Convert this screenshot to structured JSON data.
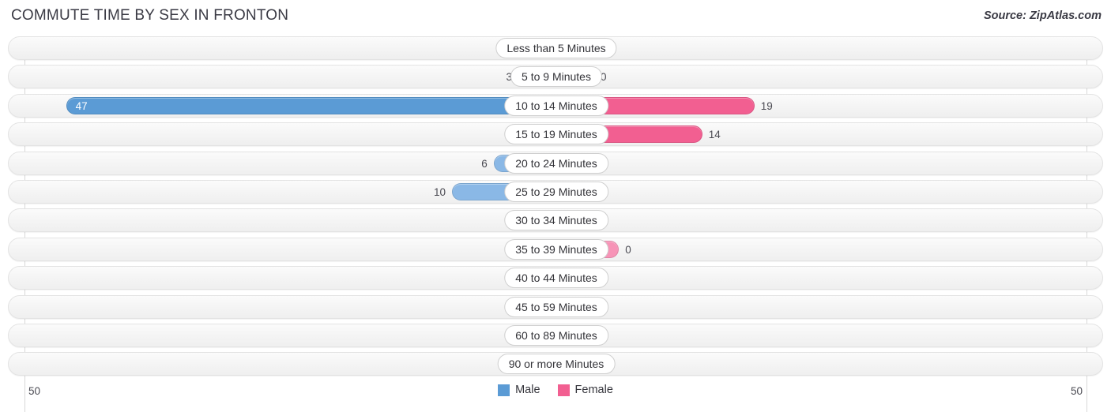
{
  "header": {
    "title": "COMMUTE TIME BY SEX IN FRONTON",
    "source": "Source: ZipAtlas.com"
  },
  "legend": {
    "items": [
      {
        "label": "Male",
        "color": "#5b9bd5"
      },
      {
        "label": "Female",
        "color": "#f25f91"
      }
    ]
  },
  "axis": {
    "left_label": "50",
    "right_label": "50",
    "max": 50
  },
  "colors": {
    "male_light": "#8ab8e6",
    "male_strong": "#5b9bd5",
    "female_light": "#f794b7",
    "female_strong": "#f25f91",
    "track": "#f4f4f4",
    "track_border": "#e3e3e3",
    "gridline": "#d8d8d8"
  },
  "chart_data": {
    "type": "bar",
    "title": "COMMUTE TIME BY SEX IN FRONTON",
    "subtitle": "Source: ZipAtlas.com",
    "orientation": "horizontal-diverging",
    "xlabel": "",
    "ylabel": "",
    "xlim": [
      -50,
      50
    ],
    "grid": true,
    "legend_position": "bottom-center",
    "categories": [
      "Less than 5 Minutes",
      "5 to 9 Minutes",
      "10 to 14 Minutes",
      "15 to 19 Minutes",
      "20 to 24 Minutes",
      "25 to 29 Minutes",
      "30 to 34 Minutes",
      "35 to 39 Minutes",
      "40 to 44 Minutes",
      "45 to 59 Minutes",
      "60 to 89 Minutes",
      "90 or more Minutes"
    ],
    "series": [
      {
        "name": "Male",
        "values": [
          0,
          3,
          47,
          0,
          6,
          10,
          0,
          0,
          0,
          0,
          0,
          0
        ]
      },
      {
        "name": "Female",
        "values": [
          0,
          0,
          19,
          14,
          0,
          0,
          0,
          6,
          0,
          0,
          0,
          0
        ]
      }
    ]
  },
  "rows": [
    {
      "category": "Less than 5 Minutes",
      "male": "0",
      "female": "0"
    },
    {
      "category": "5 to 9 Minutes",
      "male": "3",
      "female": "0"
    },
    {
      "category": "10 to 14 Minutes",
      "male": "47",
      "female": "19"
    },
    {
      "category": "15 to 19 Minutes",
      "male": "0",
      "female": "14"
    },
    {
      "category": "20 to 24 Minutes",
      "male": "6",
      "female": "0"
    },
    {
      "category": "25 to 29 Minutes",
      "male": "10",
      "female": "0"
    },
    {
      "category": "30 to 34 Minutes",
      "male": "0",
      "female": "0"
    },
    {
      "category": "35 to 39 Minutes",
      "male": "0",
      "female": "0"
    },
    {
      "category": "40 to 44 Minutes",
      "male": "0",
      "female": "0"
    },
    {
      "category": "45 to 59 Minutes",
      "male": "0",
      "female": "0"
    },
    {
      "category": "60 to 89 Minutes",
      "male": "0",
      "female": "0"
    },
    {
      "category": "90 or more Minutes",
      "male": "0",
      "female": "0"
    }
  ]
}
